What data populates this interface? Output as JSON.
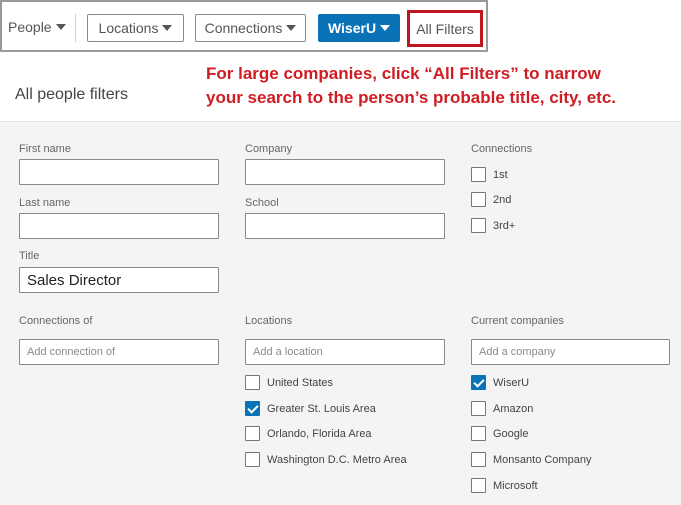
{
  "toolbar": {
    "people_label": "People",
    "locations_label": "Locations",
    "connections_label": "Connections",
    "wiseru_label": "WiserU",
    "all_filters_label": "All Filters"
  },
  "callout": {
    "line1": "For large companies, click “All Filters” to narrow",
    "line2": "your search to the person’s probable title, city, etc."
  },
  "panel_title": "All people filters",
  "fields": {
    "first_name": {
      "label": "First name",
      "value": ""
    },
    "last_name": {
      "label": "Last name",
      "value": ""
    },
    "title": {
      "label": "Title",
      "value": "Sales Director"
    },
    "company": {
      "label": "Company",
      "value": ""
    },
    "school": {
      "label": "School",
      "value": ""
    }
  },
  "connections": {
    "label": "Connections",
    "options": [
      {
        "label": "1st",
        "checked": false
      },
      {
        "label": "2nd",
        "checked": false
      },
      {
        "label": "3rd+",
        "checked": false
      }
    ]
  },
  "connections_of": {
    "label": "Connections of",
    "placeholder": "Add connection of"
  },
  "locations": {
    "label": "Locations",
    "placeholder": "Add a location",
    "options": [
      {
        "label": "United States",
        "checked": false
      },
      {
        "label": "Greater St. Louis Area",
        "checked": true
      },
      {
        "label": "Orlando, Florida Area",
        "checked": false
      },
      {
        "label": "Washington D.C. Metro Area",
        "checked": false
      }
    ]
  },
  "current_companies": {
    "label": "Current companies",
    "placeholder": "Add a company",
    "options": [
      {
        "label": "WiserU",
        "checked": true
      },
      {
        "label": "Amazon",
        "checked": false
      },
      {
        "label": "Google",
        "checked": false
      },
      {
        "label": "Monsanto Company",
        "checked": false
      },
      {
        "label": "Microsoft",
        "checked": false
      }
    ]
  },
  "colors": {
    "accent": "#0a73b8",
    "callout": "#d01c23"
  }
}
